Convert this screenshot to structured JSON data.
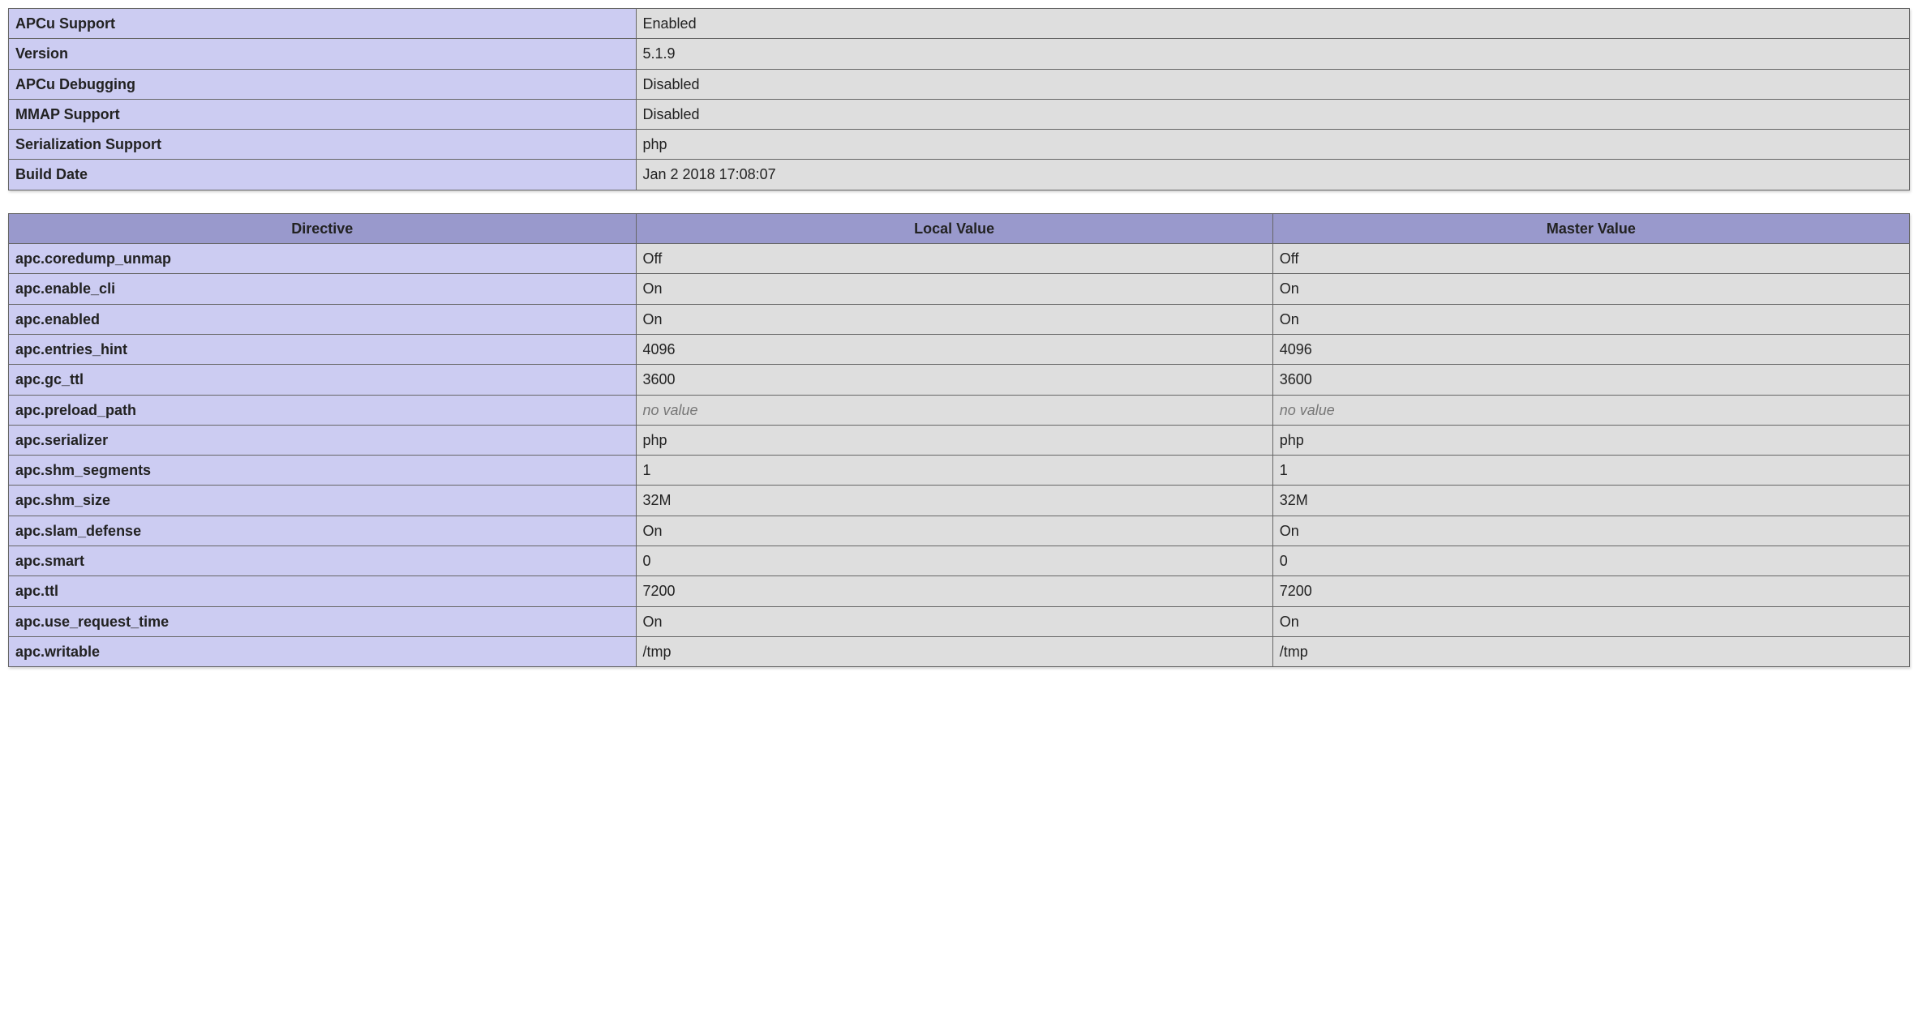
{
  "info_table": {
    "rows": [
      {
        "label": "APCu Support",
        "value": "Enabled"
      },
      {
        "label": "Version",
        "value": "5.1.9"
      },
      {
        "label": "APCu Debugging",
        "value": "Disabled"
      },
      {
        "label": "MMAP Support",
        "value": "Disabled"
      },
      {
        "label": "Serialization Support",
        "value": "php"
      },
      {
        "label": "Build Date",
        "value": "Jan 2 2018 17:08:07"
      }
    ]
  },
  "directives_table": {
    "headers": {
      "directive": "Directive",
      "local": "Local Value",
      "master": "Master Value"
    },
    "no_value_text": "no value",
    "rows": [
      {
        "directive": "apc.coredump_unmap",
        "local": "Off",
        "master": "Off"
      },
      {
        "directive": "apc.enable_cli",
        "local": "On",
        "master": "On"
      },
      {
        "directive": "apc.enabled",
        "local": "On",
        "master": "On"
      },
      {
        "directive": "apc.entries_hint",
        "local": "4096",
        "master": "4096"
      },
      {
        "directive": "apc.gc_ttl",
        "local": "3600",
        "master": "3600"
      },
      {
        "directive": "apc.preload_path",
        "local": null,
        "master": null
      },
      {
        "directive": "apc.serializer",
        "local": "php",
        "master": "php"
      },
      {
        "directive": "apc.shm_segments",
        "local": "1",
        "master": "1"
      },
      {
        "directive": "apc.shm_size",
        "local": "32M",
        "master": "32M"
      },
      {
        "directive": "apc.slam_defense",
        "local": "On",
        "master": "On"
      },
      {
        "directive": "apc.smart",
        "local": "0",
        "master": "0"
      },
      {
        "directive": "apc.ttl",
        "local": "7200",
        "master": "7200"
      },
      {
        "directive": "apc.use_request_time",
        "local": "On",
        "master": "On"
      },
      {
        "directive": "apc.writable",
        "local": "/tmp",
        "master": "/tmp"
      }
    ]
  }
}
